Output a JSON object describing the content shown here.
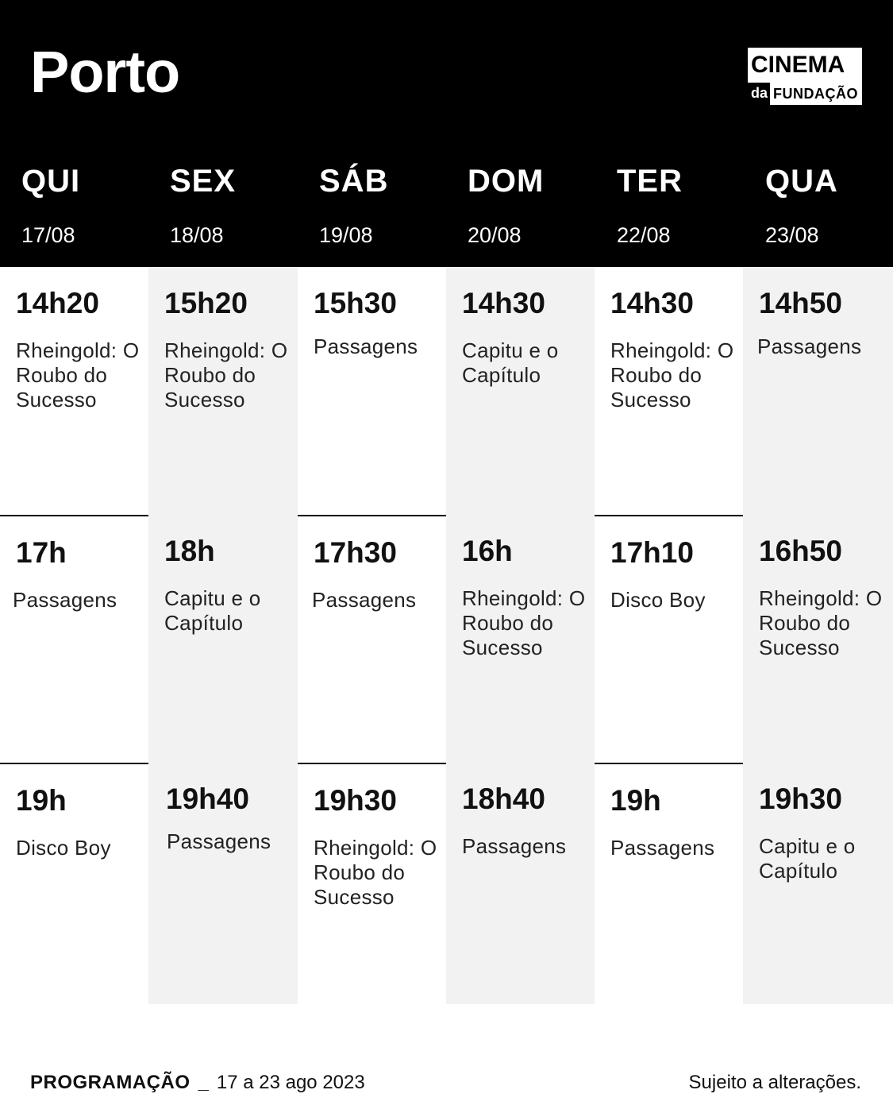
{
  "header": {
    "city": "Porto",
    "logo": {
      "line1": "CINEMA",
      "da": "da",
      "line2": "FUNDAÇÃO"
    }
  },
  "days": [
    {
      "name": "QUI",
      "date": "17/08"
    },
    {
      "name": "SEX",
      "date": "18/08"
    },
    {
      "name": "SÁB",
      "date": "19/08"
    },
    {
      "name": "DOM",
      "date": "20/08"
    },
    {
      "name": "TER",
      "date": "22/08"
    },
    {
      "name": "QUA",
      "date": "23/08"
    }
  ],
  "schedule": [
    [
      {
        "time": "14h20",
        "title": "Rheingold: O Roubo do Sucesso"
      },
      {
        "time": "17h",
        "title": "Passagens"
      },
      {
        "time": "19h",
        "title": "Disco Boy"
      }
    ],
    [
      {
        "time": "15h20",
        "title": "Rheingold: O Roubo do Sucesso"
      },
      {
        "time": "18h",
        "title": "Capitu e o Capítulo"
      },
      {
        "time": "19h40",
        "title": "Passagens"
      }
    ],
    [
      {
        "time": "15h30",
        "title": "Passagens"
      },
      {
        "time": "17h30",
        "title": "Passagens"
      },
      {
        "time": "19h30",
        "title": "Rheingold: O Roubo do Sucesso"
      }
    ],
    [
      {
        "time": "14h30",
        "title": "Capitu e o Capítulo"
      },
      {
        "time": "16h",
        "title": "Rheingold: O Roubo do Sucesso"
      },
      {
        "time": "18h40",
        "title": "Passagens"
      }
    ],
    [
      {
        "time": "14h30",
        "title": "Rheingold: O Roubo do Sucesso"
      },
      {
        "time": "17h10",
        "title": "Disco Boy"
      },
      {
        "time": "19h",
        "title": "Passagens"
      }
    ],
    [
      {
        "time": "14h50",
        "title": "Passagens"
      },
      {
        "time": "16h50",
        "title": "Rheingold: O Roubo do Sucesso"
      },
      {
        "time": "19h30",
        "title": "Capitu e o Capítulo"
      }
    ]
  ],
  "footer": {
    "program_label": "PROGRAMAÇÃO",
    "separator": "_",
    "date_range": "17 a 23 ago 2023",
    "note": "Sujeito a alterações."
  }
}
